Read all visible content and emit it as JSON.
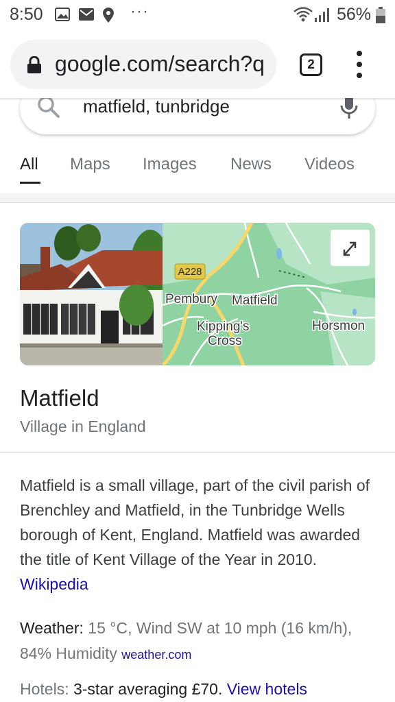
{
  "status_bar": {
    "time": "8:50",
    "dots": "···",
    "battery": "56%",
    "icons": [
      "image-icon",
      "mail-icon",
      "location-icon",
      "wifi-icon",
      "signal-icon",
      "battery-icon"
    ]
  },
  "browser": {
    "url": "google.com/search?q",
    "tab_count": "2"
  },
  "search": {
    "query": "matfield, tunbridge"
  },
  "tabs": [
    {
      "label": "All",
      "active": true
    },
    {
      "label": "Maps"
    },
    {
      "label": "Images"
    },
    {
      "label": "News"
    },
    {
      "label": "Videos"
    }
  ],
  "map": {
    "road_label": "A228",
    "places": [
      "Pembury",
      "Matfield",
      "Kipping's",
      "Cross",
      "Horsmon"
    ]
  },
  "knowledge_panel": {
    "title": "Matfield",
    "subtitle": "Village in England",
    "description": "Matfield is a small village, part of the civil parish of Brenchley and Matfield, in the Tunbridge Wells borough of Kent, England. Matfield was awarded the title of Kent Village of the Year in 2010.",
    "source_link": "Wikipedia",
    "weather_label": "Weather:",
    "weather_value": "15 °C, Wind SW at 10 mph (16 km/h), 84% Humidity",
    "weather_source": "weather.com",
    "hotels_label": "Hotels:",
    "hotels_value": "3-star averaging £70.",
    "hotels_link": "View hotels"
  },
  "colors": {
    "link": "#1a0dab",
    "map_green": "#8fd3a3",
    "map_light": "#b7e4c5",
    "road_yellow": "#f6d76a"
  }
}
